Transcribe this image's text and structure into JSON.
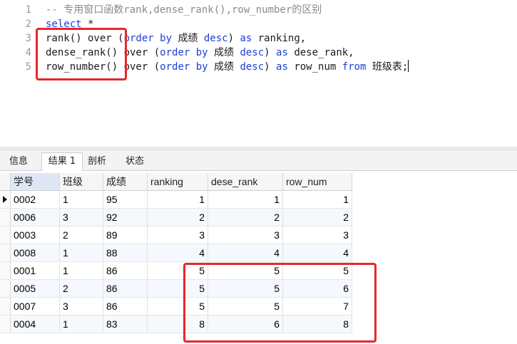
{
  "editor": {
    "line_numbers": [
      "1",
      "2",
      "3",
      "4",
      "5"
    ],
    "lines": [
      [
        {
          "t": "-- 专用窗口函数rank,dense_rank(),row_number的区别",
          "c": "cm"
        }
      ],
      [
        {
          "t": "select",
          "c": "kw"
        },
        {
          "t": " *",
          "c": ""
        }
      ],
      [
        {
          "t": "rank() over (",
          "c": ""
        },
        {
          "t": "order by",
          "c": "kw"
        },
        {
          "t": " 成绩 ",
          "c": ""
        },
        {
          "t": "desc",
          "c": "kw"
        },
        {
          "t": ") ",
          "c": ""
        },
        {
          "t": "as",
          "c": "kw"
        },
        {
          "t": " ranking,",
          "c": ""
        }
      ],
      [
        {
          "t": "dense_rank() over (",
          "c": ""
        },
        {
          "t": "order by",
          "c": "kw"
        },
        {
          "t": " 成绩 ",
          "c": ""
        },
        {
          "t": "desc",
          "c": "kw"
        },
        {
          "t": ") ",
          "c": ""
        },
        {
          "t": "as",
          "c": "kw"
        },
        {
          "t": " dese_rank,",
          "c": ""
        }
      ],
      [
        {
          "t": "row_number() over (",
          "c": ""
        },
        {
          "t": "order by",
          "c": "kw"
        },
        {
          "t": " 成绩 ",
          "c": ""
        },
        {
          "t": "desc",
          "c": "kw"
        },
        {
          "t": ") ",
          "c": ""
        },
        {
          "t": "as",
          "c": "kw"
        },
        {
          "t": " row_num ",
          "c": ""
        },
        {
          "t": "from",
          "c": "kw"
        },
        {
          "t": " 班级表;",
          "c": ""
        }
      ]
    ]
  },
  "tabs": [
    {
      "label": "信息",
      "active": false
    },
    {
      "label": "结果 1",
      "active": true
    },
    {
      "label": "剖析",
      "active": false
    },
    {
      "label": "状态",
      "active": false
    }
  ],
  "result": {
    "columns": [
      "学号",
      "班级",
      "成绩",
      "ranking",
      "dese_rank",
      "row_num"
    ],
    "rows": [
      [
        "0002",
        "1",
        "95",
        "1",
        "1",
        "1"
      ],
      [
        "0006",
        "3",
        "92",
        "2",
        "2",
        "2"
      ],
      [
        "0003",
        "2",
        "89",
        "3",
        "3",
        "3"
      ],
      [
        "0008",
        "1",
        "88",
        "4",
        "4",
        "4"
      ],
      [
        "0001",
        "1",
        "86",
        "5",
        "5",
        "5"
      ],
      [
        "0005",
        "2",
        "86",
        "5",
        "5",
        "6"
      ],
      [
        "0007",
        "3",
        "86",
        "5",
        "5",
        "7"
      ],
      [
        "0004",
        "1",
        "83",
        "8",
        "6",
        "8"
      ]
    ],
    "current_row_index": 0,
    "selected_column_index": 0
  },
  "colors": {
    "keyword": "#1f3fd6",
    "comment": "#8a8a8a",
    "highlight_box": "#e8262b",
    "alt_row": "#f5f8fc"
  }
}
